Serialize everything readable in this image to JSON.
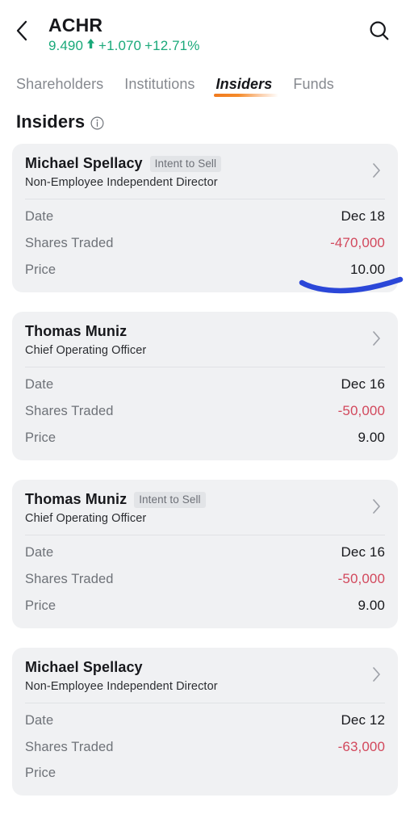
{
  "header": {
    "back_icon": "chevron-left-icon",
    "search_icon": "search-icon",
    "symbol": "ACHR",
    "price": "9.490",
    "arrow": "▲",
    "change": "+1.070",
    "change_pct": "+12.71%",
    "positive_color": "#1aa97a"
  },
  "tabs": [
    {
      "label": "Shareholders",
      "active": false
    },
    {
      "label": "Institutions",
      "active": false
    },
    {
      "label": "Insiders",
      "active": true
    },
    {
      "label": "Funds",
      "active": false
    }
  ],
  "section": {
    "title": "Insiders",
    "info_icon": "info-circle-icon"
  },
  "row_labels": {
    "date": "Date",
    "shares_traded": "Shares Traded",
    "price": "Price"
  },
  "cards": [
    {
      "name": "Michael Spellacy",
      "badge": "Intent to Sell",
      "role": "Non-Employee Independent Director",
      "date": "Dec 18",
      "shares_traded": "-470,000",
      "price": "10.00",
      "chevron_icon": "chevron-right-icon"
    },
    {
      "name": "Thomas Muniz",
      "badge": "",
      "role": "Chief Operating Officer",
      "date": "Dec 16",
      "shares_traded": "-50,000",
      "price": "9.00",
      "chevron_icon": "chevron-right-icon"
    },
    {
      "name": "Thomas Muniz",
      "badge": "Intent to Sell",
      "role": "Chief Operating Officer",
      "date": "Dec 16",
      "shares_traded": "-50,000",
      "price": "9.00",
      "chevron_icon": "chevron-right-icon"
    },
    {
      "name": "Michael Spellacy",
      "badge": "",
      "role": "Non-Employee Independent Director",
      "date": "Dec 12",
      "shares_traded": "-63,000",
      "price": "",
      "chevron_icon": "chevron-right-icon"
    }
  ],
  "annotation": {
    "type": "handwritten-underline",
    "color": "#2b47d8",
    "target": "-470,000"
  },
  "colors": {
    "negative": "#d2485c",
    "card_bg": "#f0f1f3",
    "badge_bg": "#e2e4e7",
    "tab_accent": "#f07a1e"
  }
}
